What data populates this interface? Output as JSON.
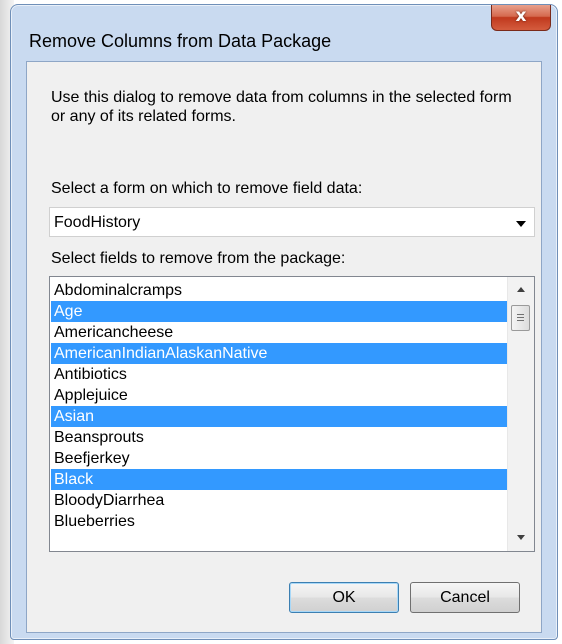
{
  "dialog": {
    "title": "Remove Columns from Data Package",
    "close_glyph": "x",
    "description": "Use this dialog to remove data from columns in the selected form or any of its related forms."
  },
  "form_select": {
    "label": "Select a form on which to remove field data:",
    "value": "FoodHistory"
  },
  "fields": {
    "label": "Select fields to remove from the package:",
    "items": [
      {
        "label": "Abdominalcramps",
        "selected": false
      },
      {
        "label": "Age",
        "selected": true
      },
      {
        "label": "Americancheese",
        "selected": false
      },
      {
        "label": "AmericanIndianAlaskanNative",
        "selected": true
      },
      {
        "label": "Antibiotics",
        "selected": false
      },
      {
        "label": "Applejuice",
        "selected": false
      },
      {
        "label": "Asian",
        "selected": true
      },
      {
        "label": "Beansprouts",
        "selected": false
      },
      {
        "label": "Beefjerkey",
        "selected": false
      },
      {
        "label": "Black",
        "selected": true
      },
      {
        "label": "BloodyDiarrhea",
        "selected": false
      },
      {
        "label": "Blueberries",
        "selected": false
      }
    ]
  },
  "buttons": {
    "ok": "OK",
    "cancel": "Cancel"
  },
  "colors": {
    "selection": "#3399ff",
    "frame": "#c9daf0",
    "close_button": "#c0391d"
  },
  "icons": {
    "close": "close-icon",
    "dropdown": "chevron-down-icon",
    "scroll_up": "scroll-up-icon",
    "scroll_down": "scroll-down-icon"
  }
}
